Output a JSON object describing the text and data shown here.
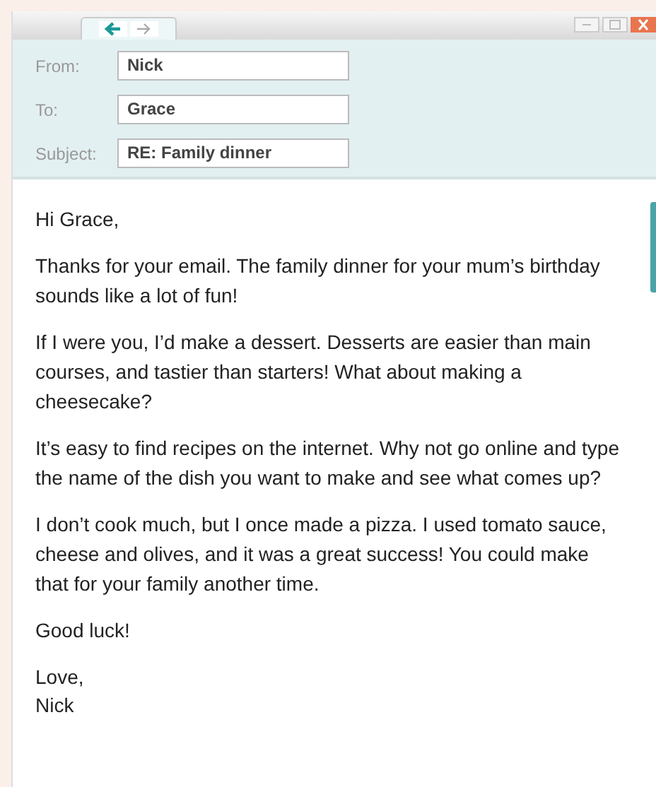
{
  "header": {
    "fields": [
      {
        "label": "From:",
        "value": "Nick"
      },
      {
        "label": "To:",
        "value": "Grace"
      },
      {
        "label": "Subject:",
        "value": "RE: Family dinner"
      }
    ]
  },
  "body": {
    "paragraphs": [
      "Hi Grace,",
      "Thanks for your email. The family dinner for your mum’s birthday sounds like a lot of fun!",
      "If I were you, I’d make a dessert. Desserts are easier than main courses, and tastier than starters! What about making a cheesecake?",
      "It’s easy to find recipes on the internet. Why not go online and type the name of the dish you want to make and see what comes up?",
      "I don’t cook much, but I once made a pizza. I used tomato sauce, cheese and olives, and it was a great success! You could make that for your family another time.",
      "Good luck!"
    ],
    "signoff": [
      "Love,",
      "Nick"
    ]
  }
}
